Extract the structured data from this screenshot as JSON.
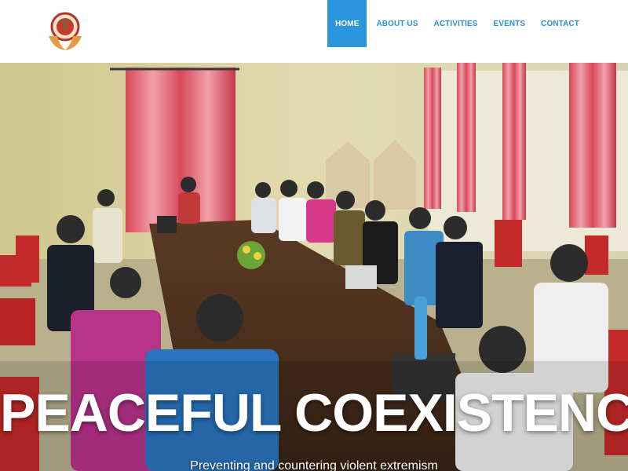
{
  "header": {
    "logo_icon": "hands-holding-globe-icon",
    "nav": [
      {
        "label": "HOME",
        "active": true
      },
      {
        "label": "ABOUT US"
      },
      {
        "label": "ACTIVITIES"
      },
      {
        "label": "EVENTS"
      },
      {
        "label": "CONTACT"
      }
    ],
    "accent_color": "#2b95dd"
  },
  "hero": {
    "title": "PEACEFUL COEXISTENCE",
    "subtitle": "Preventing and countering violent extremism"
  }
}
